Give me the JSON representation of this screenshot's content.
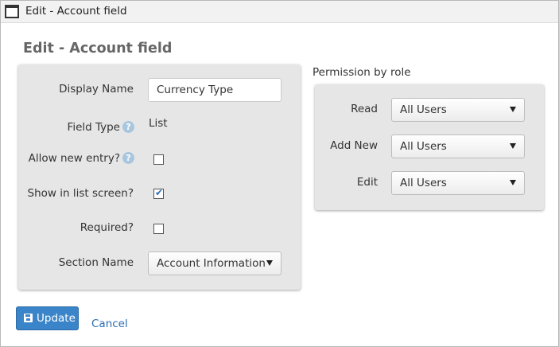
{
  "window": {
    "title": "Edit - Account field"
  },
  "page": {
    "title": "Edit - Account field"
  },
  "form": {
    "display_name": {
      "label": "Display Name",
      "value": "Currency Type"
    },
    "field_type": {
      "label": "Field Type",
      "value": "List",
      "help": "?"
    },
    "allow_new_entry": {
      "label": "Allow new entry?",
      "checked": false,
      "help": "?"
    },
    "show_in_list": {
      "label": "Show in list screen?",
      "checked": true,
      "checkmark": "✔"
    },
    "required": {
      "label": "Required?",
      "checked": false
    },
    "section_name": {
      "label": "Section Name",
      "value": "Account Information"
    }
  },
  "permissions": {
    "title": "Permission by role",
    "read": {
      "label": "Read",
      "value": "All Users"
    },
    "add_new": {
      "label": "Add New",
      "value": "All Users"
    },
    "edit": {
      "label": "Edit",
      "value": "All Users"
    }
  },
  "actions": {
    "update_label": "Update",
    "cancel_label": "Cancel"
  },
  "icons": {
    "window": "window-icon",
    "help": "help-icon",
    "save": "save-icon",
    "dropdown": "chevron-down-icon"
  },
  "colors": {
    "primary": "#3a84c9",
    "link": "#2a6db5",
    "panel": "#e6e6e6",
    "help_icon": "#a9c6df"
  }
}
